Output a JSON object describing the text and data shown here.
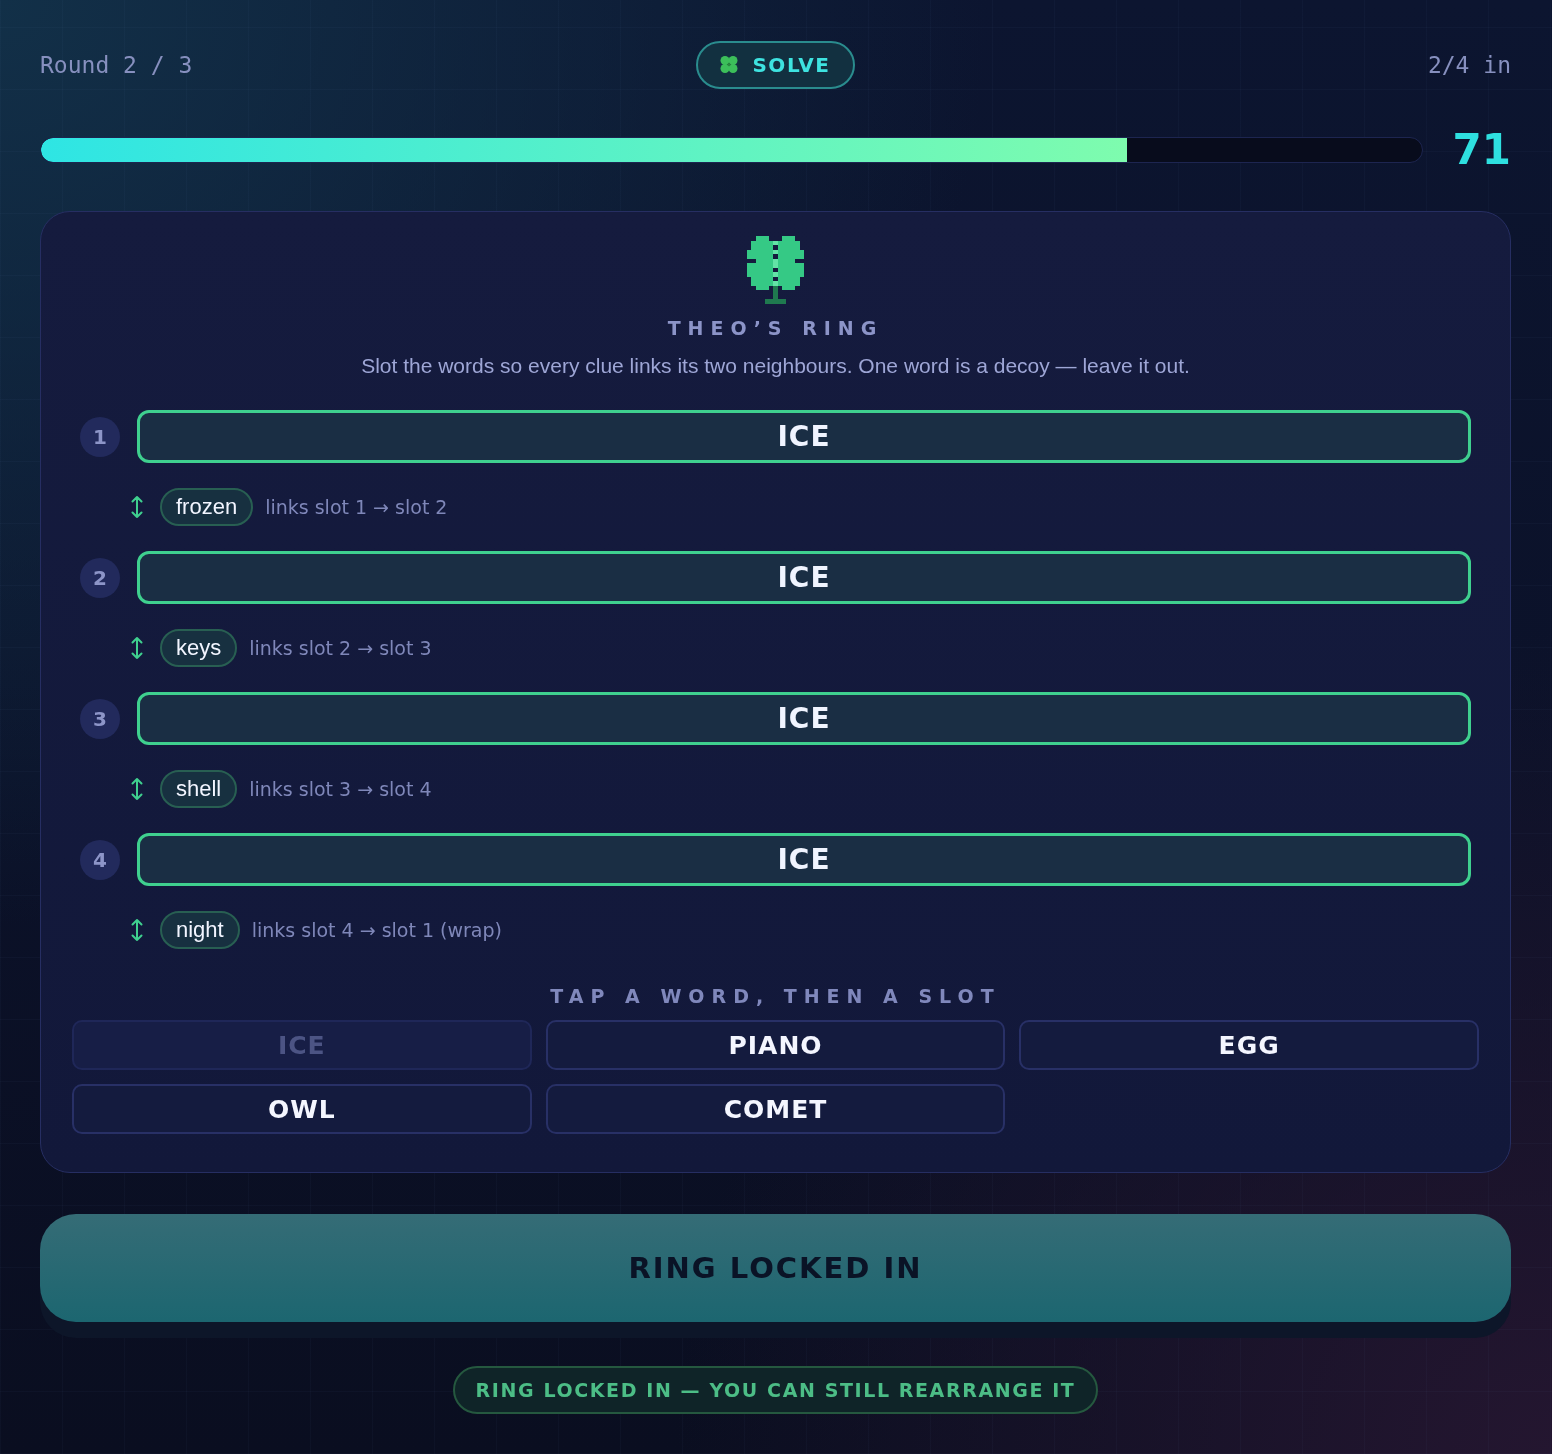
{
  "header": {
    "round": "Round 2 / 3",
    "mode": "SOLVE",
    "placed": "2/4 in"
  },
  "meter": {
    "level": 0.787,
    "reading": "71"
  },
  "puzzle": {
    "title": "THEO’S RING",
    "instructions": "Slot the words so every clue links its two neighbours. One word is a decoy — leave it out.",
    "slots": [
      {
        "number": "1",
        "word": "ICE",
        "filled": true,
        "clue": "frozen",
        "link": "links slot 1 → slot 2"
      },
      {
        "number": "2",
        "word": "ICE",
        "filled": true,
        "clue": "keys",
        "link": "links slot 2 → slot 3"
      },
      {
        "number": "3",
        "word": "ICE",
        "filled": true,
        "clue": "shell",
        "link": "links slot 3 → slot 4"
      },
      {
        "number": "4",
        "word": "ICE",
        "filled": true,
        "clue": "night",
        "link": "links slot 4 → slot 1 (wrap)"
      }
    ],
    "bank_label": "TAP A WORD, THEN A SLOT",
    "words": [
      {
        "label": "ICE",
        "used": true
      },
      {
        "label": "PIANO",
        "used": false
      },
      {
        "label": "EGG",
        "used": false
      },
      {
        "label": "OWL",
        "used": false
      },
      {
        "label": "COMET",
        "used": false
      }
    ]
  },
  "lock_button": {
    "label": "RING LOCKED IN",
    "locked": true
  },
  "status": "RING LOCKED IN — YOU CAN STILL REARRANGE IT"
}
